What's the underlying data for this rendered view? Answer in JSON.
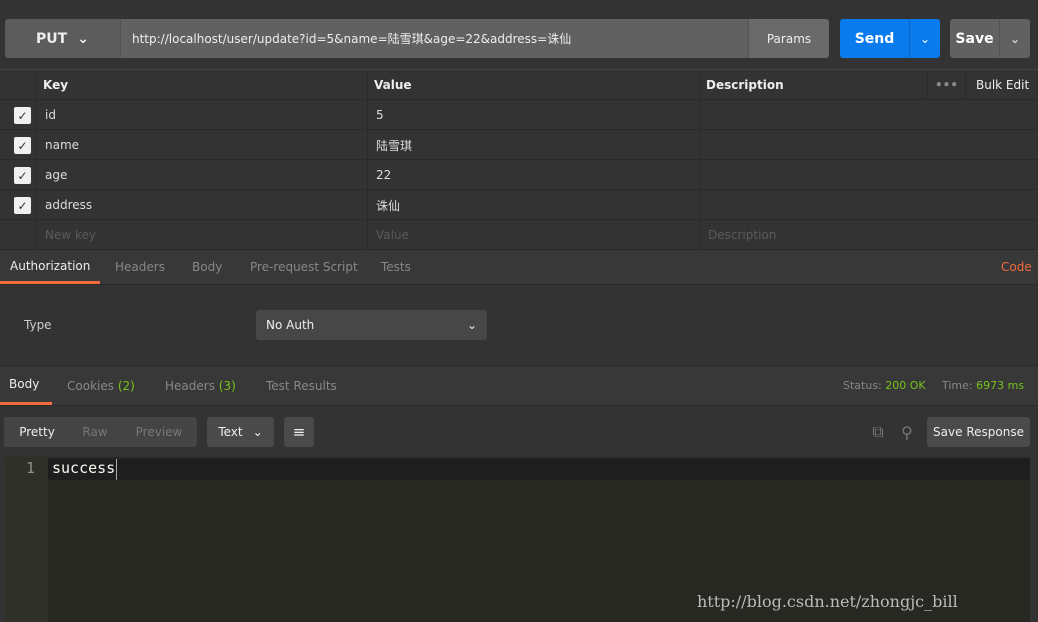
{
  "request": {
    "method": "PUT",
    "url": "http://localhost/user/update?id=5&name=陆雪琪&age=22&address=诛仙",
    "params_label": "Params",
    "send_label": "Send",
    "save_label": "Save"
  },
  "params_table": {
    "headers": {
      "key": "Key",
      "value": "Value",
      "description": "Description",
      "bulk_edit": "Bulk Edit"
    },
    "rows": [
      {
        "key": "id",
        "value": "5",
        "checked": true
      },
      {
        "key": "name",
        "value": "陆雪琪",
        "checked": true
      },
      {
        "key": "age",
        "value": "22",
        "checked": true
      },
      {
        "key": "address",
        "value": "诛仙",
        "checked": true
      }
    ],
    "placeholders": {
      "key": "New key",
      "value": "Value",
      "description": "Description"
    }
  },
  "request_tabs": {
    "items": [
      "Authorization",
      "Headers",
      "Body",
      "Pre-request Script",
      "Tests"
    ],
    "active": "Authorization",
    "code_link": "Code"
  },
  "auth": {
    "type_label": "Type",
    "type_value": "No Auth"
  },
  "response_tabs": {
    "body": "Body",
    "cookies": "Cookies",
    "cookies_count": "(2)",
    "headers": "Headers",
    "headers_count": "(3)",
    "test_results": "Test Results"
  },
  "status": {
    "status_label": "Status:",
    "status_value": "200 OK",
    "time_label": "Time:",
    "time_value": "6973 ms"
  },
  "response_toolbar": {
    "pretty": "Pretty",
    "raw": "Raw",
    "preview": "Preview",
    "format": "Text",
    "save_response": "Save Response"
  },
  "editor": {
    "line_number": "1",
    "content": "success"
  },
  "watermark": "http://blog.csdn.net/zhongjc_bill",
  "colors": {
    "accent": "#f26b3a",
    "send": "#097bed",
    "success": "#77c31b"
  }
}
